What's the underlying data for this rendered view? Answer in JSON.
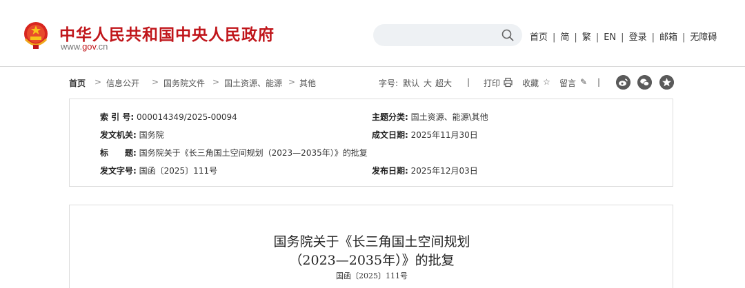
{
  "header": {
    "site_name": "中华人民共和国中央人民政府",
    "site_url_prefix": "www.",
    "site_url_brand": "gov",
    "site_url_suffix": ".cn",
    "search_placeholder": "",
    "nav": [
      "首页",
      "简",
      "繁",
      "EN",
      "登录",
      "邮箱",
      "无障碍"
    ],
    "nav_separator": "|",
    "brand_color": "#c0161b"
  },
  "breadcrumb": {
    "items": [
      "首页",
      "信息公开",
      "国务院文件",
      "国土资源、能源",
      "其他"
    ],
    "arrow": ">"
  },
  "tools": {
    "font_label": "字号:",
    "font_default": "默认",
    "font_large": "大",
    "font_xlarge": "超大",
    "divider": "|",
    "print": "打印",
    "favorite": "收藏",
    "comment": "留言",
    "divider2": "|",
    "share_icons": [
      "weibo-icon",
      "wechat-icon",
      "qzone-icon"
    ]
  },
  "meta": {
    "index_label": "索 引 号:",
    "index_value": "000014349/2025-00094",
    "subject_label": "主题分类:",
    "subject_value": "国土资源、能源\\其他",
    "issuer_label": "发文机关:",
    "issuer_value": "国务院",
    "created_label": "成文日期:",
    "created_value": "2025年11月30日",
    "title_label": "标　　题:",
    "title_value": "国务院关于《长三角国土空间规划（2023—2035年）》的批复",
    "docno_label": "发文字号:",
    "docno_value": "国函〔2025〕111号",
    "published_label": "发布日期:",
    "published_value": "2025年12月03日"
  },
  "article": {
    "title_line1": "国务院关于《长三角国土空间规划",
    "title_line2": "（2023—2035年）》的批复",
    "doc_number": "国函〔2025〕111号"
  }
}
